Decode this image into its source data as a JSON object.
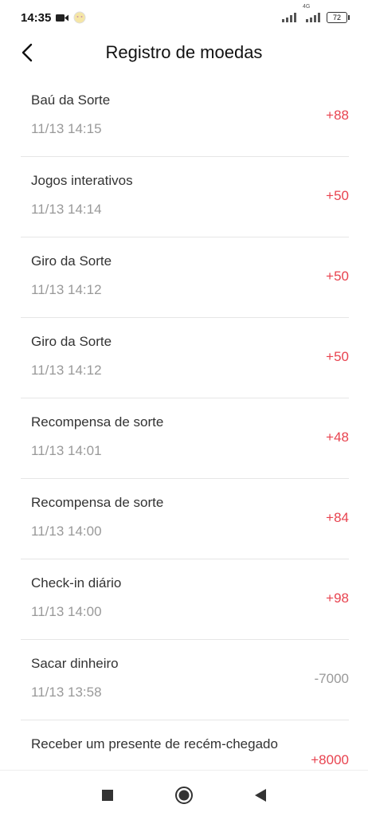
{
  "status_bar": {
    "time": "14:35",
    "network": "4G",
    "battery": "72"
  },
  "header": {
    "title": "Registro de moedas"
  },
  "records": [
    {
      "name": "Baú da Sorte",
      "time": "11/13 14:15",
      "amount": "+88"
    },
    {
      "name": "Jogos interativos",
      "time": "11/13 14:14",
      "amount": "+50"
    },
    {
      "name": "Giro da Sorte",
      "time": "11/13 14:12",
      "amount": "+50"
    },
    {
      "name": "Giro da Sorte",
      "time": "11/13 14:12",
      "amount": "+50"
    },
    {
      "name": "Recompensa de sorte",
      "time": "11/13 14:01",
      "amount": "+48"
    },
    {
      "name": "Recompensa de sorte",
      "time": "11/13 14:00",
      "amount": "+84"
    },
    {
      "name": "Check-in diário",
      "time": "11/13 14:00",
      "amount": "+98"
    },
    {
      "name": "Sacar dinheiro",
      "time": "11/13 13:58",
      "amount": "-7000"
    },
    {
      "name": "Receber um presente de recém-chegado",
      "time": "",
      "amount": "+8000"
    }
  ],
  "colors": {
    "positive_amount": "#e8434f",
    "negative_amount": "#999999"
  },
  "icons": {
    "back": "chevron-left-icon",
    "nav_recent": "square-icon",
    "nav_home": "circle-icon",
    "nav_back": "triangle-left-icon"
  }
}
